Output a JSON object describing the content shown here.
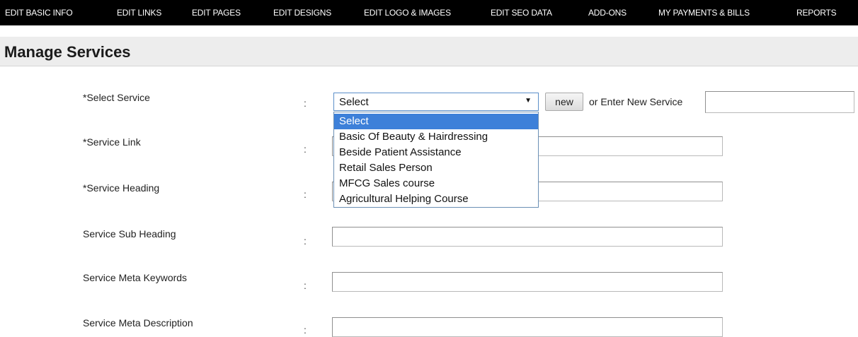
{
  "topnav": {
    "items": [
      "EDIT BASIC INFO",
      "EDIT LINKS",
      "EDIT PAGES",
      "EDIT DESIGNS",
      "EDIT LOGO & IMAGES",
      "EDIT SEO DATA",
      "ADD-ONS",
      "MY PAYMENTS & BILLS",
      "REPORTS"
    ]
  },
  "page_title": "Manage Services",
  "form": {
    "colon": ":",
    "select_service": {
      "label": "*Select Service",
      "value": "Select",
      "new_button": "new",
      "or_text": "or Enter New Service",
      "new_service_value": "",
      "options": [
        "Select",
        "Basic Of Beauty & Hairdressing",
        "Beside Patient Assistance",
        "Retail Sales Person",
        "MFCG Sales course",
        "Agricultural Helping Course"
      ],
      "highlighted_option": "Select"
    },
    "service_link": {
      "label": "*Service Link",
      "value": ""
    },
    "service_heading": {
      "label": "*Service Heading",
      "value": ""
    },
    "service_sub_heading": {
      "label": "Service Sub Heading",
      "value": ""
    },
    "service_meta_keywords": {
      "label": "Service Meta Keywords",
      "value": ""
    },
    "service_meta_description": {
      "label": "Service Meta Description",
      "value": ""
    }
  },
  "colors": {
    "nav_background": "#000000",
    "title_background": "#ededed",
    "dropdown_highlight": "#3d80d9"
  }
}
